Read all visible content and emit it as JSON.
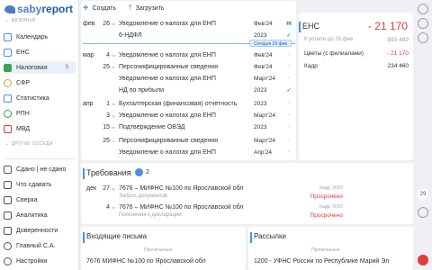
{
  "brand": {
    "a": "saby",
    "b": "report"
  },
  "sidebar": {
    "section_base": "БАЗОВЫЙ",
    "section_other": "ДРУГИЕ СОСЕДИ",
    "items": [
      {
        "label": "Календарь",
        "color": "#4a8fe0"
      },
      {
        "label": "ЕНС",
        "color": "#4a8fe0"
      },
      {
        "label": "Налоговая",
        "count": "9",
        "color": "#3aa356"
      },
      {
        "label": "СФР",
        "color": "#e29b2b"
      },
      {
        "label": "Статистика",
        "color": "#4a8fe0"
      },
      {
        "label": "РПН",
        "color": "#3aa356"
      },
      {
        "label": "МВД",
        "color": "#e03b3b"
      }
    ],
    "items2": [
      {
        "label": "Сдано | не сдано"
      },
      {
        "label": "Что сдавать"
      },
      {
        "label": "Сверка"
      },
      {
        "label": "Аналитика"
      },
      {
        "label": "Доверенности"
      },
      {
        "label": "Главный С.А."
      },
      {
        "label": "Настройки"
      }
    ]
  },
  "toolbar": {
    "create": "Создать",
    "upload": "Загрузить"
  },
  "calendar": {
    "rows": [
      {
        "mo": "фев",
        "dd": "26",
        "dw": "пн",
        "t": "Уведомление о налогах для ЕНП",
        "p": "Фев'24",
        "st": "▮▮",
        "cls": "doc"
      },
      {
        "mo": "",
        "dd": "",
        "dw": "",
        "t": "6-НДФЛ",
        "p": "2023",
        "st": "✓",
        "cls": "ok"
      },
      {
        "mo": "мар",
        "dd": "4",
        "dw": "пн",
        "t": "Уведомление о налогах для ЕНП",
        "p": "Фев'24",
        "st": "◦",
        "cls": ""
      },
      {
        "mo": "",
        "dd": "25",
        "dw": "пн",
        "t": "Персонифицированные сведения",
        "p": "Фев'24",
        "st": "◦",
        "cls": ""
      },
      {
        "mo": "",
        "dd": "",
        "dw": "",
        "t": "Уведомление о налогах для ЕНП",
        "p": "Март'24",
        "st": "◦",
        "cls": ""
      },
      {
        "mo": "",
        "dd": "",
        "dw": "",
        "t": "НД по прибыли",
        "p": "2023",
        "st": "✓",
        "cls": "ok"
      },
      {
        "mo": "апр",
        "dd": "1",
        "dw": "пн",
        "t": "Бухгалтерская (финансовая) отчетность",
        "p": "2023",
        "st": "◦",
        "cls": ""
      },
      {
        "mo": "",
        "dd": "3",
        "dw": "ср",
        "t": "Уведомление о налогах для ЕНП",
        "p": "Март'24",
        "st": "◦",
        "cls": ""
      },
      {
        "mo": "",
        "dd": "15",
        "dw": "пн",
        "t": "Подтверждение ОВЭД",
        "p": "2023",
        "st": "◦",
        "cls": ""
      },
      {
        "mo": "",
        "dd": "25",
        "dw": "чт",
        "t": "Персонифицированные сведения",
        "p": "Март'24",
        "st": "◦",
        "cls": ""
      },
      {
        "mo": "",
        "dd": "",
        "dw": "",
        "t": "Уведомление о налогах для ЕНП",
        "p": "Апр'24",
        "st": "◦",
        "cls": ""
      }
    ],
    "today": "Сегодня 29 фев"
  },
  "ens": {
    "title": "ЕНС",
    "sum": "- 21 170",
    "lines": [
      {
        "k": "К уплате до 28 фев",
        "v": "893 489",
        "kc": "g",
        "vc": "g"
      },
      {
        "k": "Цветы (с филиалами)",
        "v": "- 21 170",
        "kc": "",
        "vc": "r"
      },
      {
        "k": "Кадр",
        "v": "234 460",
        "kc": "",
        "vc": ""
      }
    ]
  },
  "requirements": {
    "title": "Требования",
    "count": "2",
    "items": [
      {
        "mo": "дек",
        "dd": "27",
        "dw": "ср",
        "t1": "7676 – МИФНС №100 по Ярославской обл",
        "t2": "Запрос документов",
        "org": "Кадр, ООО",
        "stat": "Просрочено"
      },
      {
        "mo": "",
        "dd": "4",
        "dw": "пн",
        "t1": "7676 – МИФНС №100 по Ярославской обл",
        "t2": "Пояснения к декларации",
        "org": "Кадр, ООО",
        "stat": "Просрочено"
      }
    ]
  },
  "inbox": {
    "title": "Входящие письма",
    "tag": "Прочитанные",
    "line": "7676 МИФНС №100 по Ярославской обл"
  },
  "mailings": {
    "title": "Рассылки",
    "tag": "Прочитанные",
    "line": "1200 - УФНС России по Республике Марий Эл"
  },
  "rail": {
    "num": "29"
  }
}
